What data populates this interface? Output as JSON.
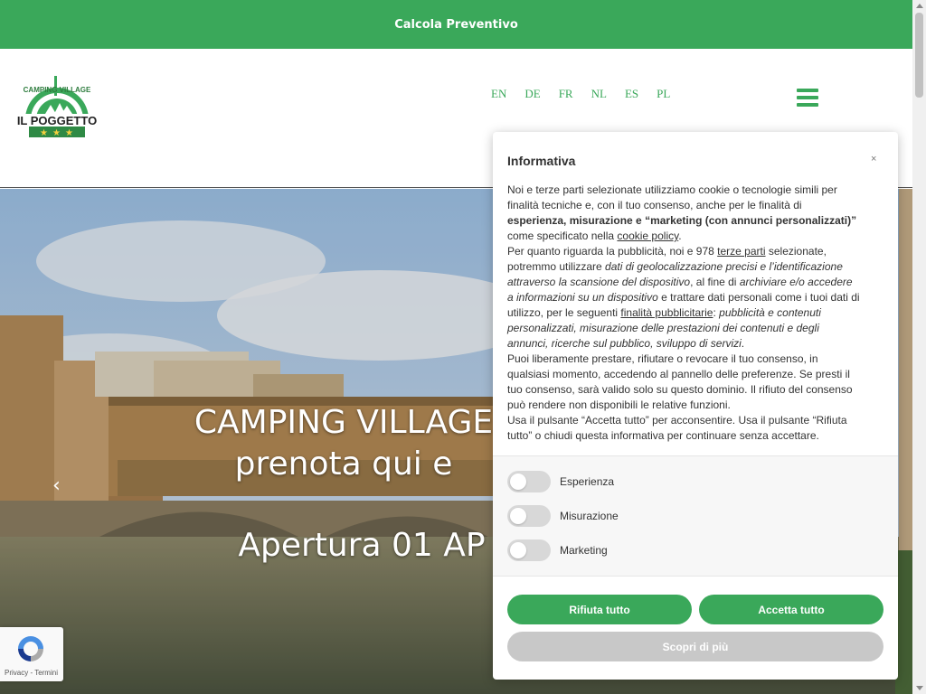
{
  "topbar": {
    "label": "Calcola Preventivo"
  },
  "logo": {
    "line1": "CAMPING VILLAGE",
    "line2": "IL POGGETTO"
  },
  "languages": [
    "EN",
    "DE",
    "FR",
    "NL",
    "ES",
    "PL"
  ],
  "hero": {
    "title_line1": "CAMPING VILLAGE",
    "title_line2": "prenota qui e",
    "subtitle": "Apertura 01 AP",
    "prev_arrow": "‹"
  },
  "recaptcha": {
    "text": "Privacy - Termini"
  },
  "consent": {
    "title": "Informativa",
    "close": "×",
    "p1_a": "Noi e terze parti selezionate utilizziamo cookie o tecnologie simili per finalità tecniche e, con il tuo consenso, anche per le finalità di ",
    "p1_b": "esperienza, misurazione e “marketing (con annunci personalizzati)”",
    "p1_c": " come specificato nella ",
    "p1_link": "cookie policy",
    "p1_d": ".",
    "p2_a": "Per quanto riguarda la pubblicità, noi e 978 ",
    "p2_link1": "terze parti",
    "p2_b": " selezionate, potremmo utilizzare ",
    "p2_i1": "dati di geolocalizzazione precisi e l’identificazione attraverso la scansione del dispositivo",
    "p2_c": ", al fine di ",
    "p2_i2": "archiviare e/o accedere a informazioni su un dispositivo",
    "p2_d": " e trattare dati personali come i tuoi dati di utilizzo, per le seguenti ",
    "p2_link2": "finalità pubblicitarie",
    "p2_e": ": ",
    "p2_i3": "pubblicità e contenuti personalizzati, misurazione delle prestazioni dei contenuti e degli annunci, ricerche sul pubblico, sviluppo di servizi",
    "p2_f": ".",
    "p3": "Puoi liberamente prestare, rifiutare o revocare il tuo consenso, in qualsiasi momento, accedendo al pannello delle preferenze. Se presti il tuo consenso, sarà valido solo su questo dominio. Il rifiuto del consenso può rendere non disponibili le relative funzioni.",
    "p4": "Usa il pulsante “Accetta tutto” per acconsentire. Usa il pulsante “Rifiuta tutto” o chiudi questa informativa per continuare senza accettare.",
    "toggles": [
      {
        "label": "Esperienza",
        "on": false
      },
      {
        "label": "Misurazione",
        "on": false
      },
      {
        "label": "Marketing",
        "on": false
      }
    ],
    "reject_label": "Rifiuta tutto",
    "accept_label": "Accetta tutto",
    "more_label": "Scopri di più"
  },
  "colors": {
    "brand_green": "#3aa85a",
    "more_button": "#c8c8c8"
  }
}
